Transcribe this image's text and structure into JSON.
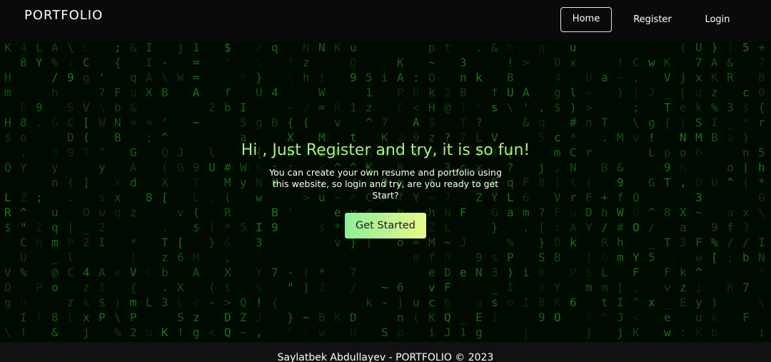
{
  "header": {
    "brand": "PORTFOLIO",
    "nav": [
      {
        "label": "Home",
        "active": true
      },
      {
        "label": "Register",
        "active": false
      },
      {
        "label": "Login",
        "active": false
      }
    ]
  },
  "hero": {
    "title": "Hi , Just Register and try, it is so fun!",
    "subtitle": "You can create your own resume and portfolio using this website, so login and try, are you ready to get Start?",
    "cta_label": "Get Started"
  },
  "footer": {
    "text": "Saylatbek Abdullayev - PORTFOLIO © 2023"
  },
  "background": {
    "style": "matrix-rain",
    "glyph_color": "#2bd62b",
    "charset": "ABCDEFGHIJKLMNOPQRSTUVWXYZabcdefghijklmnopqrstuvwxyz0123456789$+-*/=%\"'#&_(),.;:?!\\|{}<>[]^~@"
  },
  "colors": {
    "title": "#a9ef7e",
    "cta_gradient_start": "#8ef09a",
    "cta_gradient_end": "#e7f88a",
    "navbar_bg": "#0a0a0a",
    "footer_bg": "#111111"
  }
}
